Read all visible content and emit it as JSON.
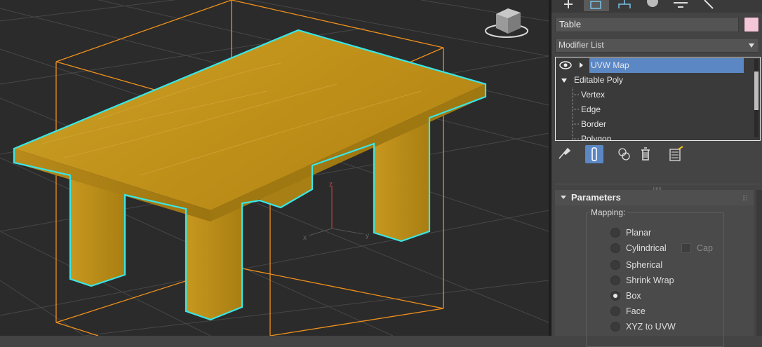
{
  "viewport": {
    "object_name": "Table",
    "axis_labels": {
      "x": "x",
      "y": "y",
      "z": "z"
    },
    "colors": {
      "background": "#2b2b2b",
      "grid": "#4a4a4a",
      "bbox": "#f0901c",
      "highlight": "#39e6e6",
      "wood_light": "#c9961a",
      "wood_dark": "#a77d10"
    }
  },
  "command_panel": {
    "tabs": [
      "create-icon",
      "modify-icon",
      "hierarchy-icon",
      "motion-icon",
      "display-icon",
      "utilities-icon"
    ],
    "active_tab": 1,
    "object_name": "Table",
    "object_color": "#f4c6d7",
    "modifier_list_label": "Modifier List",
    "stack": [
      {
        "label": "UVW Map",
        "selected": true,
        "level": 0,
        "expandable": true
      },
      {
        "label": "Editable Poly",
        "selected": false,
        "level": 0,
        "expanded": true
      },
      {
        "label": "Vertex",
        "selected": false,
        "level": 1
      },
      {
        "label": "Edge",
        "selected": false,
        "level": 1
      },
      {
        "label": "Border",
        "selected": false,
        "level": 1
      },
      {
        "label": "Polygon",
        "selected": false,
        "level": 1
      }
    ],
    "stack_tools": [
      "pin-stack-icon",
      "show-end-result-icon",
      "make-unique-icon",
      "remove-modifier-icon",
      "configure-modifier-sets-icon"
    ],
    "parameters": {
      "title": "Parameters",
      "mapping_label": "Mapping:",
      "options": [
        "Planar",
        "Cylindrical",
        "Spherical",
        "Shrink Wrap",
        "Box",
        "Face",
        "XYZ to UVW"
      ],
      "selected": "Box",
      "cap_label": "Cap"
    }
  }
}
